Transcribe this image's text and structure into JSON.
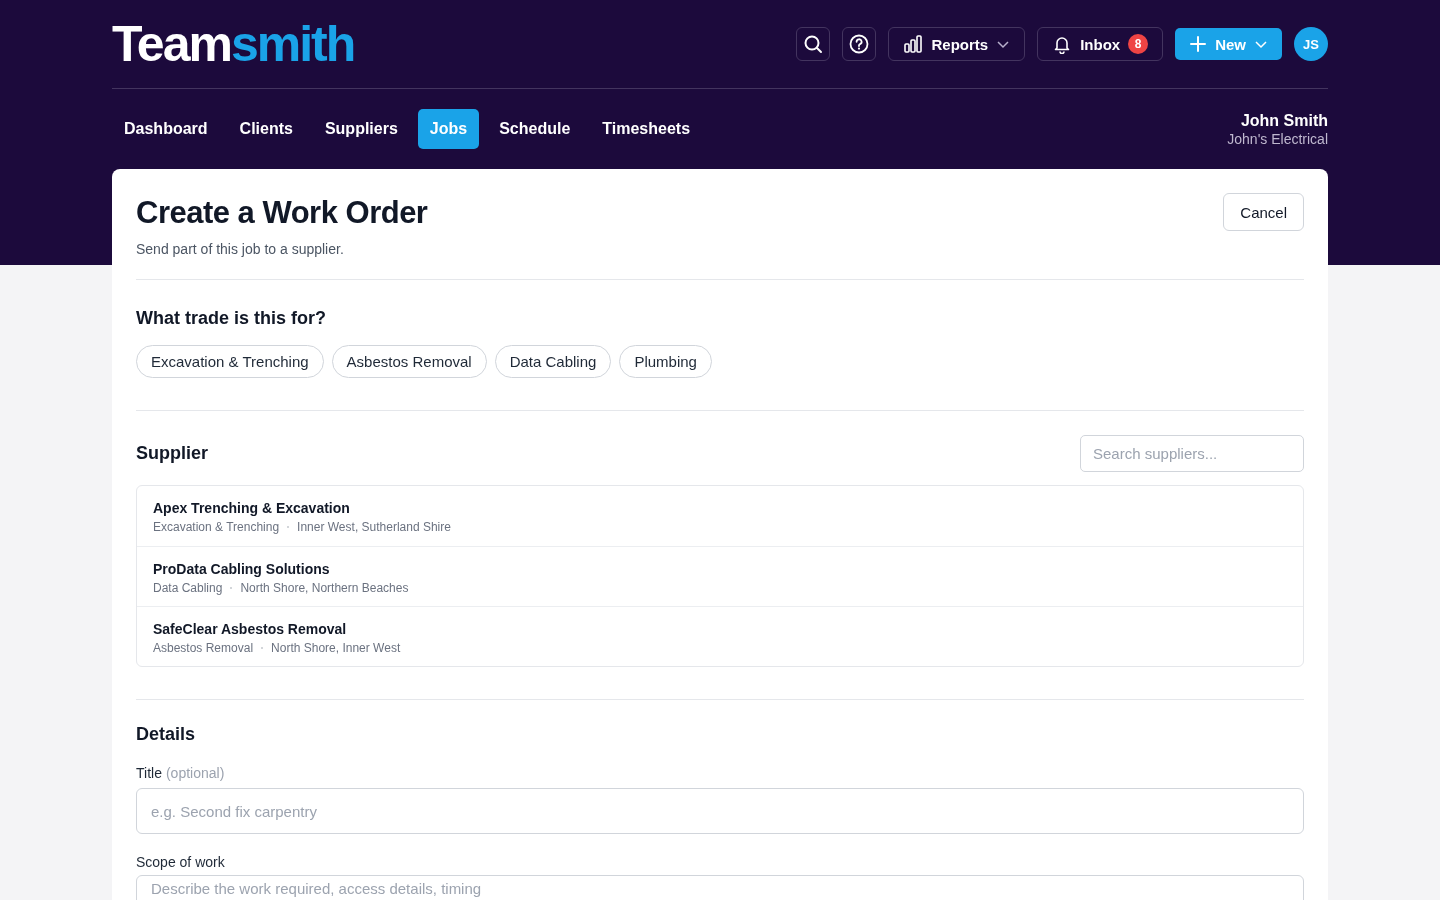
{
  "logo": {
    "first": "Team",
    "second": "smith"
  },
  "toolbar": {
    "reports": "Reports",
    "inbox": "Inbox",
    "inbox_count": "8",
    "new": "New",
    "avatar": "JS"
  },
  "nav": [
    {
      "label": "Dashboard",
      "selected": false
    },
    {
      "label": "Clients",
      "selected": false
    },
    {
      "label": "Suppliers",
      "selected": false
    },
    {
      "label": "Jobs",
      "selected": true
    },
    {
      "label": "Schedule",
      "selected": false
    },
    {
      "label": "Timesheets",
      "selected": false
    }
  ],
  "user": {
    "name": "John Smith",
    "company": "John's Electrical"
  },
  "page": {
    "title": "Create a Work Order",
    "subtitle": "Send part of this job to a supplier.",
    "cancel": "Cancel"
  },
  "trade": {
    "heading": "What trade is this for?",
    "options": [
      {
        "label": "Excavation & Trenching",
        "selected": false
      },
      {
        "label": "Asbestos Removal",
        "selected": false
      },
      {
        "label": "Data Cabling",
        "selected": false
      },
      {
        "label": "Plumbing",
        "selected": false
      }
    ]
  },
  "supplier": {
    "heading": "Supplier",
    "search": {
      "placeholder": "Search suppliers..."
    },
    "items": [
      {
        "name": "Apex Trenching & Excavation",
        "trade": "Excavation & Trenching",
        "areas": "Inner West, Sutherland Shire"
      },
      {
        "name": "ProData Cabling Solutions",
        "trade": "Data Cabling",
        "areas": "North Shore, Northern Beaches"
      },
      {
        "name": "SafeClear Asbestos Removal",
        "trade": "Asbestos Removal",
        "areas": "North Shore, Inner West"
      }
    ]
  },
  "details": {
    "heading": "Details",
    "title_label": "Title",
    "title_hint": "(optional)",
    "title_field": {
      "placeholder": "e.g. Second fix carpentry"
    },
    "scope_label": "Scope of work",
    "scope_field": {
      "placeholder": "Describe the work required, access details, timing"
    }
  }
}
